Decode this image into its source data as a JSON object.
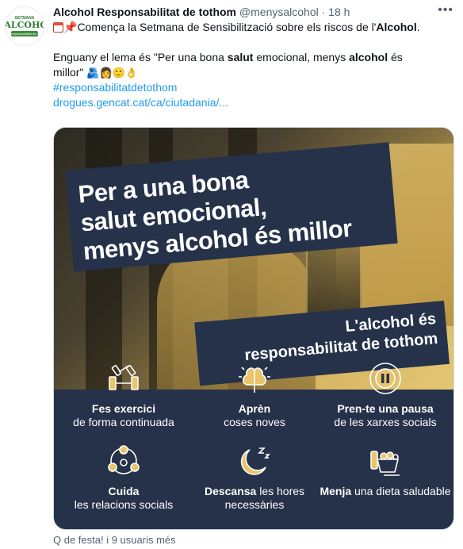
{
  "account": {
    "avatar_top": "SETMANA",
    "avatar_name": "L'ALCOHOL",
    "avatar_bar": "responsabilitat de tothom",
    "display_name": "Alcohol Responsabilitat de tothom",
    "handle": "@menysalcohol",
    "separator": "·",
    "time": "18 h"
  },
  "tweet": {
    "line1_pre": "Comença la Setmana de Sensibilització sobre els riscos de l'",
    "line1_bold": "Alcohol",
    "line1_post": ".",
    "line2_a": "Enguany el lema és \"Per una bona ",
    "line2_b": "salut",
    "line2_c": " emocional, menys ",
    "line2_d": "alcohol",
    "line2_e": " és",
    "line3_a": "millor\" ",
    "line3_emoji": "🫂👩🙂👌",
    "hashtag": "#responsabilitatdetothom",
    "link": "drogues.gencat.cat/ca/ciutadania/..."
  },
  "poster": {
    "headline": [
      "Per a una bona",
      "salut emocional,",
      "menys alcohol és millor"
    ],
    "subhead": [
      "L'alcohol és",
      "responsabilitat de tothom"
    ],
    "tiles": [
      {
        "bold": "Fes exercici",
        "normal": "de forma continuada",
        "icon": "dumbbell-icon"
      },
      {
        "bold": "Aprèn",
        "normal": "coses noves",
        "icon": "brain-icon"
      },
      {
        "bold": "Pren-te una pausa",
        "normal": "de les xarxes socials",
        "icon": "pause-icon"
      },
      {
        "bold": "Cuida",
        "normal": "les relacions socials",
        "icon": "people-network-icon"
      },
      {
        "bold": "Descansa",
        "normal": " les hores necessàries",
        "icon": "moon-sleep-icon"
      },
      {
        "bold": "Menja",
        "normal": " una dieta saludable",
        "icon": "groceries-icon"
      }
    ]
  },
  "footer": {
    "text": "Q de festa! i 9 usuaris més"
  },
  "colors": {
    "link": "#1d9bf0",
    "poster_navy": "#25324a",
    "icon_yellow": "#e9c46a"
  }
}
